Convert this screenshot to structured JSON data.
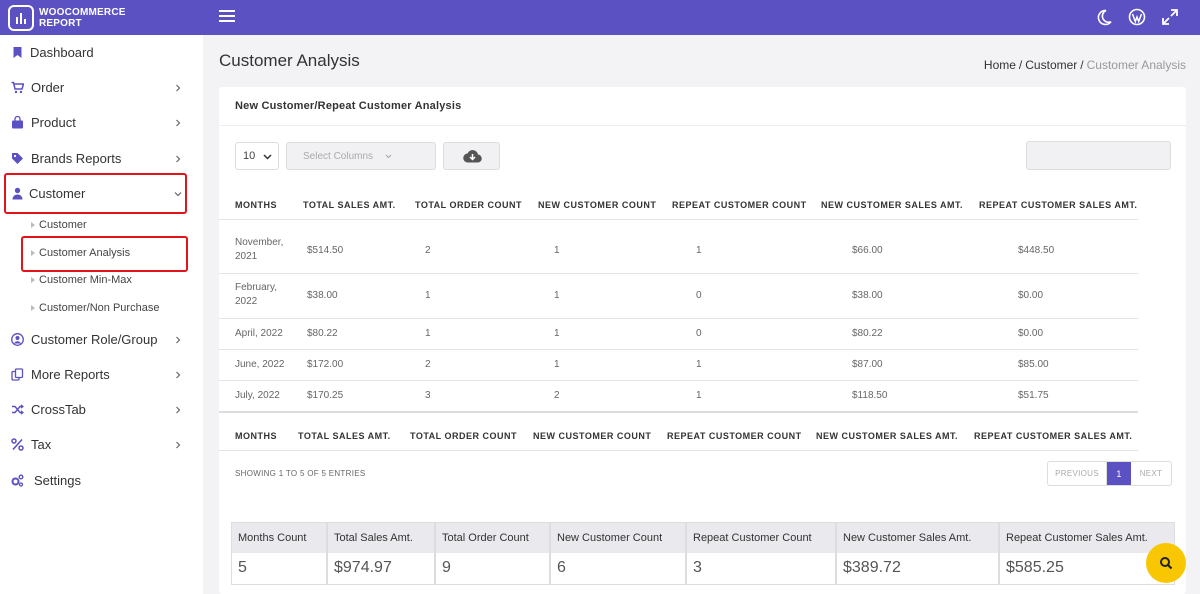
{
  "brand": {
    "line1": "WOOCOMMERCE",
    "line2": "REPORT"
  },
  "topbar_icons": [
    "menu-icon",
    "moon-icon",
    "wordpress-icon",
    "expand-icon"
  ],
  "sidebar": {
    "items": [
      {
        "label": "Dashboard",
        "icon": "bookmark-icon",
        "has_children": false
      },
      {
        "label": "Order",
        "icon": "cart-icon",
        "has_children": true
      },
      {
        "label": "Product",
        "icon": "bag-icon",
        "has_children": true
      },
      {
        "label": "Brands Reports",
        "icon": "tag-icon",
        "has_children": true
      },
      {
        "label": "Customer",
        "icon": "user-icon",
        "has_children": true,
        "expanded": true
      },
      {
        "label": "Customer Role/Group",
        "icon": "user-circle-icon",
        "has_children": true
      },
      {
        "label": "More Reports",
        "icon": "copy-icon",
        "has_children": true
      },
      {
        "label": "CrossTab",
        "icon": "shuffle-icon",
        "has_children": true
      },
      {
        "label": "Tax",
        "icon": "percent-icon",
        "has_children": true
      },
      {
        "label": "Settings",
        "icon": "gears-icon",
        "has_children": false
      }
    ],
    "customer_submenu": [
      "Customer",
      "Customer Analysis",
      "Customer Min-Max",
      "Customer/Non Purchase"
    ],
    "active_subitem": "Customer Analysis"
  },
  "page": {
    "title": "Customer Analysis",
    "breadcrumb": {
      "home": "Home",
      "sep": "/",
      "section": "Customer",
      "current": "Customer Analysis"
    }
  },
  "card": {
    "title": "New Customer/Repeat Customer Analysis",
    "page_length": "10",
    "select_columns_placeholder": "Select Columns",
    "search_value": ""
  },
  "table": {
    "headers": [
      "MONTHS",
      "TOTAL SALES AMT.",
      "TOTAL ORDER COUNT",
      "NEW CUSTOMER COUNT",
      "REPEAT CUSTOMER COUNT",
      "NEW CUSTOMER SALES AMT.",
      "REPEAT CUSTOMER SALES AMT."
    ],
    "rows": [
      [
        "November, 2021",
        "$514.50",
        "2",
        "1",
        "1",
        "$66.00",
        "$448.50"
      ],
      [
        "February, 2022",
        "$38.00",
        "1",
        "1",
        "0",
        "$38.00",
        "$0.00"
      ],
      [
        "April, 2022",
        "$80.22",
        "1",
        "1",
        "0",
        "$80.22",
        "$0.00"
      ],
      [
        "June, 2022",
        "$172.00",
        "2",
        "1",
        "1",
        "$87.00",
        "$85.00"
      ],
      [
        "July, 2022",
        "$170.25",
        "3",
        "2",
        "1",
        "$118.50",
        "$51.75"
      ]
    ]
  },
  "table_info": "SHOWING 1 TO 5 OF 5 ENTRIES",
  "pagination": {
    "previous": "PREVIOUS",
    "current": "1",
    "next": "NEXT"
  },
  "summary": [
    {
      "label": "Months Count",
      "value": "5"
    },
    {
      "label": "Total Sales Amt.",
      "value": "$974.97"
    },
    {
      "label": "Total Order Count",
      "value": "9"
    },
    {
      "label": "New Customer Count",
      "value": "6"
    },
    {
      "label": "Repeat Customer Count",
      "value": "3"
    },
    {
      "label": "New Customer Sales Amt.",
      "value": "$389.72"
    },
    {
      "label": "Repeat Customer Sales Amt.",
      "value": "$585.25"
    }
  ],
  "colors": {
    "brand": "#5b51c3",
    "highlight": "#e1141c",
    "fab": "#f8c702"
  }
}
